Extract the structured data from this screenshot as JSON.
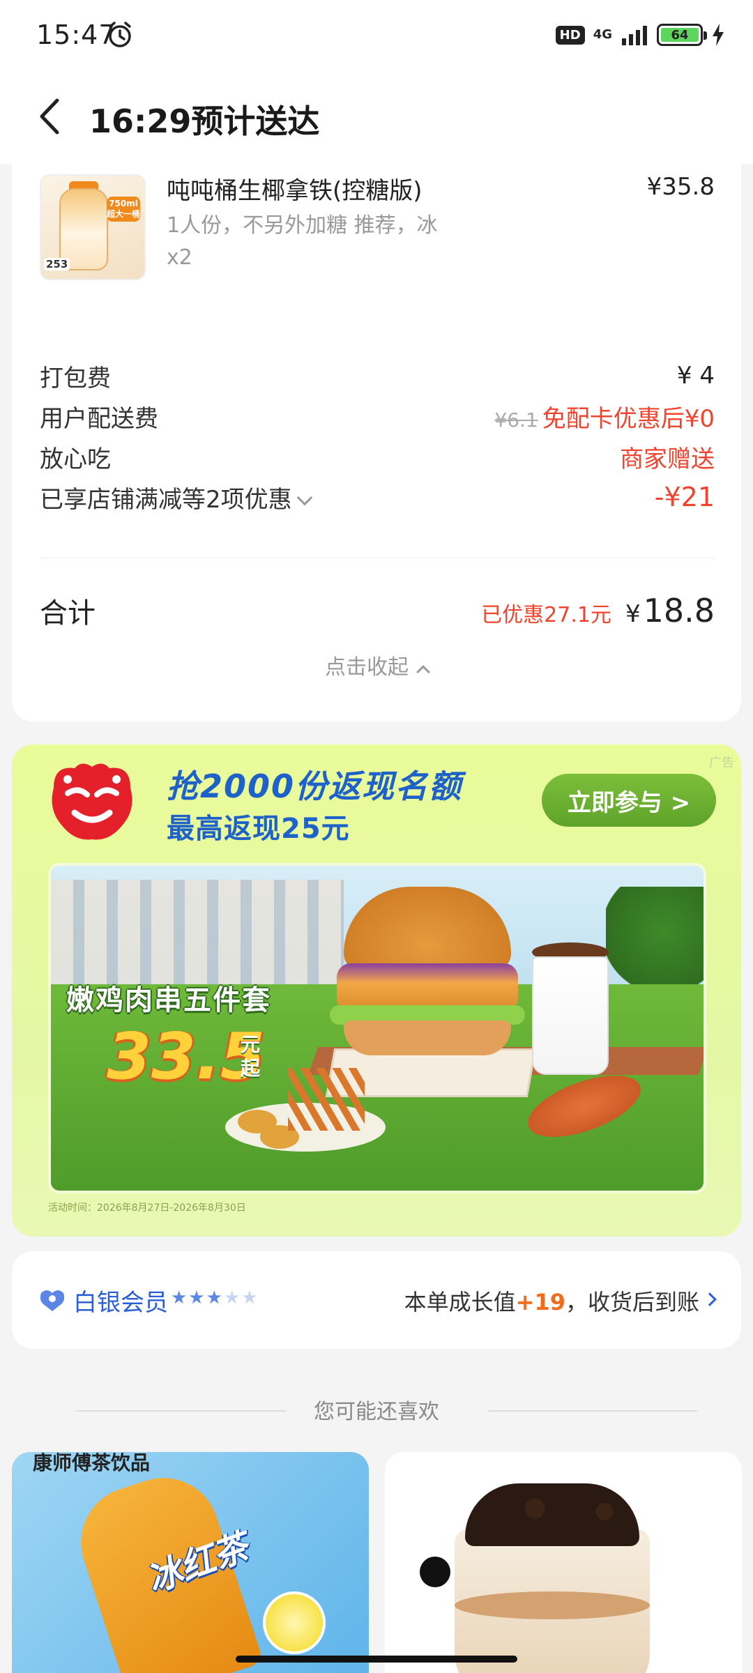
{
  "status_bar": {
    "time": "15:47",
    "hd": "HD",
    "network": "4G",
    "battery": "64"
  },
  "header": {
    "title": "16:29预计送达"
  },
  "order": {
    "product": {
      "name": "吨吨桶生椰拿铁(控糖版)",
      "spec": "1人份，不另外加糖 推荐，冰",
      "qty": "x2",
      "price": "¥35.8",
      "image_tag": "750ml 超大一桶",
      "image_num": "253"
    },
    "packaging": {
      "label": "打包费",
      "value": "¥ 4"
    },
    "delivery": {
      "label": "用户配送费",
      "original": "¥6.1",
      "value": "免配卡优惠后¥0"
    },
    "safe_eat": {
      "label": "放心吃",
      "value": "商家赠送"
    },
    "discounts": {
      "label": "已享店铺满减等2项优惠",
      "value": "-¥21"
    },
    "total": {
      "label": "合计",
      "saved": "已优惠27.1元",
      "currency": "¥",
      "amount": "18.8"
    },
    "collapse_label": "点击收起"
  },
  "ad": {
    "tag": "广告",
    "headline": "抢2000份返现名额",
    "subline": "最高返现25元",
    "button": "立即参与 >",
    "food_name": "嫩鸡肉串五件套",
    "price": "33.5",
    "price_unit_1": "元",
    "price_unit_2": "起",
    "fineprint": "活动时间：2026年8月27日-2026年8月30日"
  },
  "member": {
    "label": "白银会员",
    "stars_on": "★★★",
    "stars_off": "★★",
    "growth_prefix": "本单成长值",
    "growth_value": "+19",
    "growth_suffix": "，收货后到账"
  },
  "recommend": {
    "title": "您可能还喜欢",
    "card1_brand": "康师傅茶饮品",
    "card1_label": "冰红茶"
  },
  "colors": {
    "accent_red": "#f0442f",
    "member_blue": "#2a5fd6",
    "ad_blue": "#1e62c9",
    "ad_green": "#5ea32a"
  }
}
